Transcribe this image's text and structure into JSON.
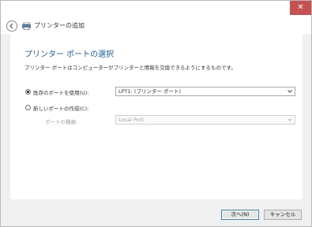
{
  "window": {
    "close_glyph": "✕",
    "title": "プリンターの追加"
  },
  "page": {
    "heading": "プリンター ポートの選択",
    "description": "プリンター ポートはコンピューターがプリンターと情報を交換できるようにするものです。"
  },
  "options": {
    "existing_port_label": "既存のポートを使用(U):",
    "existing_port_selected": true,
    "existing_port_value": "LPT1: (プリンター ポート)",
    "new_port_label": "新しいポートの作成(C):",
    "new_port_selected": false,
    "port_type_label": "ポートの種類:",
    "port_type_value": "Local Port"
  },
  "footer": {
    "next_label": "次へ(N)",
    "cancel_label": "キャンセル"
  },
  "icons": {
    "back": "back-arrow-icon",
    "wizard": "printer-icon",
    "dropdown": "chevron-down-icon",
    "close": "close-icon"
  },
  "colors": {
    "heading": "#1d5fa6",
    "close_button": "#c75050",
    "default_button_border": "#3c7fb1"
  }
}
